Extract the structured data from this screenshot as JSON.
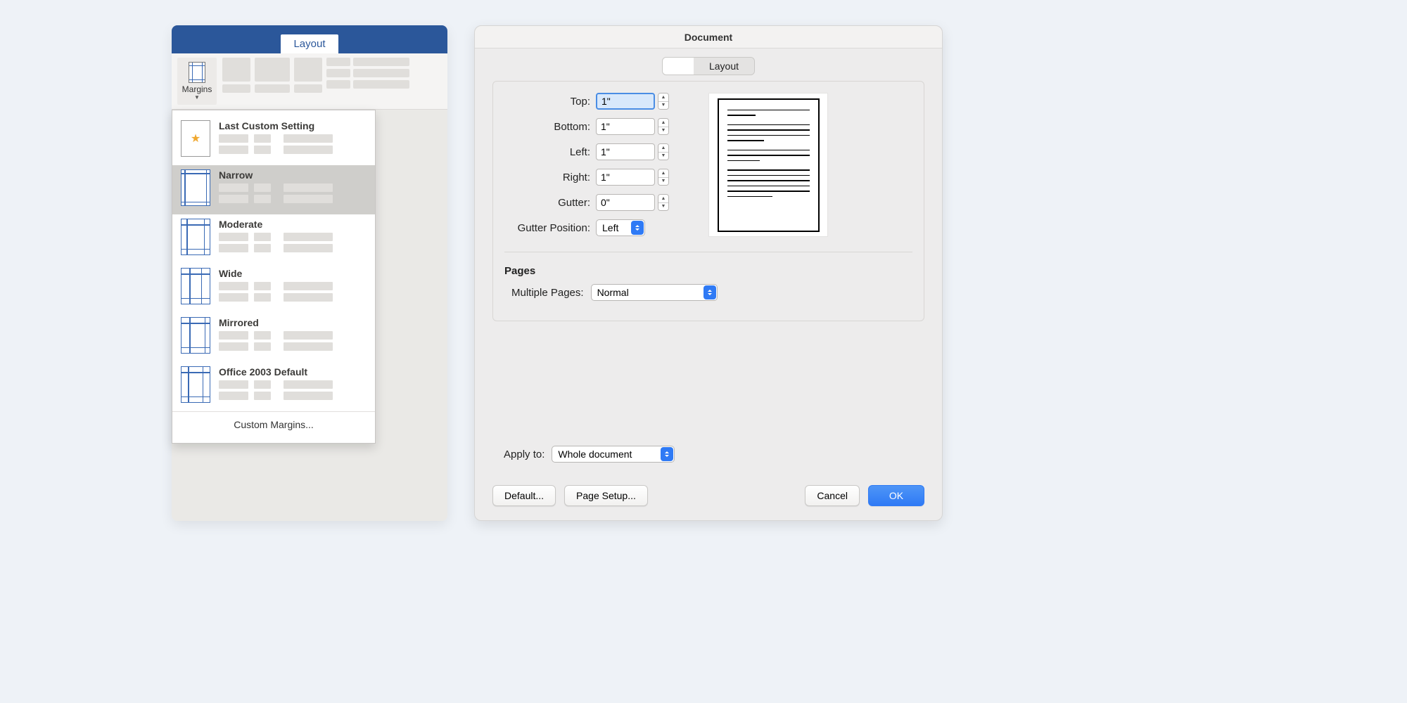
{
  "word": {
    "tab": "Layout",
    "margins_button": "Margins",
    "menu": {
      "items": [
        {
          "label": "Last Custom Setting"
        },
        {
          "label": "Narrow"
        },
        {
          "label": "Moderate"
        },
        {
          "label": "Wide"
        },
        {
          "label": "Mirrored"
        },
        {
          "label": "Office 2003 Default"
        }
      ],
      "footer": "Custom Margins..."
    }
  },
  "dialog": {
    "title": "Document",
    "tab_blank": "",
    "tab_layout": "Layout",
    "margins": {
      "top_label": "Top:",
      "top": "1\"",
      "bottom_label": "Bottom:",
      "bottom": "1\"",
      "left_label": "Left:",
      "left": "1\"",
      "right_label": "Right:",
      "right": "1\"",
      "gutter_label": "Gutter:",
      "gutter": "0\"",
      "gutter_pos_label": "Gutter Position:",
      "gutter_pos": "Left"
    },
    "pages_header": "Pages",
    "multiple_label": "Multiple Pages:",
    "multiple_value": "Normal",
    "apply_label": "Apply to:",
    "apply_value": "Whole document",
    "buttons": {
      "default": "Default...",
      "pagesetup": "Page Setup...",
      "cancel": "Cancel",
      "ok": "OK"
    }
  }
}
